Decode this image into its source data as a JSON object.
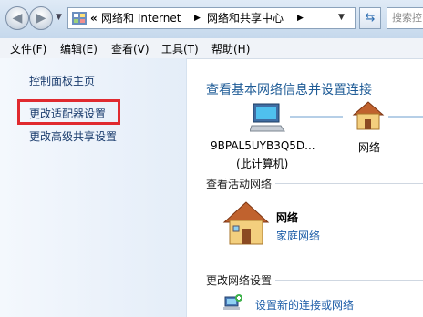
{
  "address_bar": {
    "overflow": "«",
    "crumbs": [
      "网络和 Internet",
      "网络和共享中心"
    ],
    "search_placeholder": "搜索控"
  },
  "menu": [
    "文件(F)",
    "编辑(E)",
    "查看(V)",
    "工具(T)",
    "帮助(H)"
  ],
  "left_panel": {
    "home": "控制面板主页",
    "items": [
      "更改适配器设置",
      "更改高级共享设置"
    ]
  },
  "main": {
    "heading": "查看基本网络信息并设置连接",
    "computer_name": "9BPAL5UYB3Q5D...",
    "computer_note": "(此计算机)",
    "network_node": "网络",
    "active_section": "查看活动网络",
    "active_network_name": "网络",
    "active_network_type": "家庭网络",
    "change_section": "更改网络设置",
    "setup_link": "设置新的连接或网络"
  },
  "colors": {
    "highlight": "#e02a2f",
    "link": "#1e5ea8",
    "heading": "#1e5b96"
  }
}
